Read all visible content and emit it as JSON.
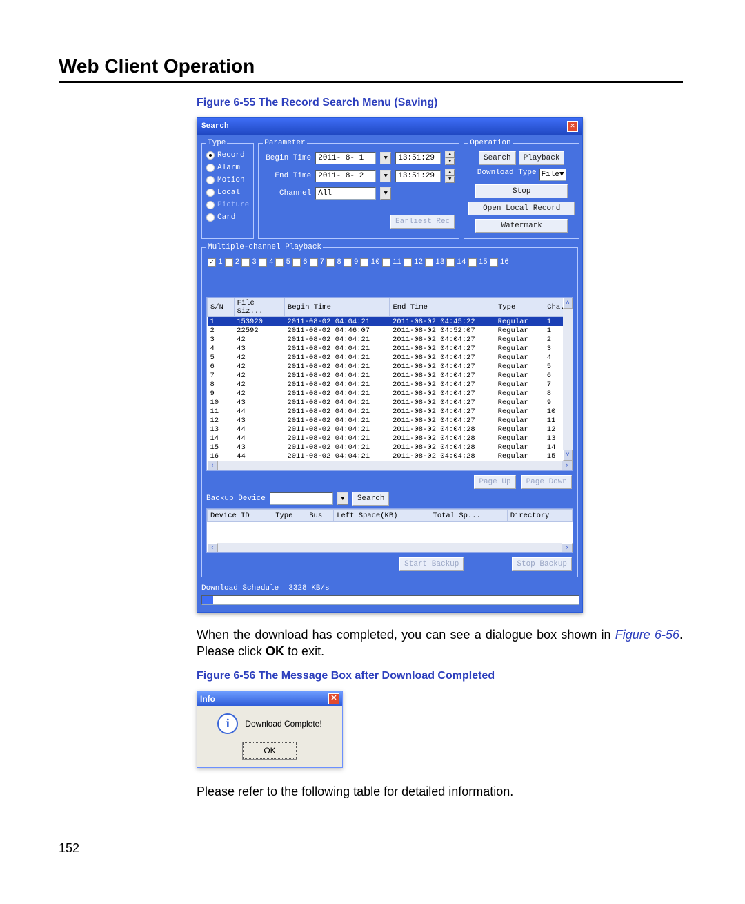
{
  "page": {
    "title": "Web Client Operation",
    "number": "152"
  },
  "caption1": "Figure 6-55 The Record Search Menu (Saving)",
  "caption2": "Figure 6-56 The Message Box after Download Completed",
  "para1a": "When the download has completed, you can see a dialogue box shown in ",
  "para1_figref": "Figure 6-56",
  "para1b": ". Please click ",
  "para1_bold": "OK",
  "para1c": " to exit.",
  "para2": "Please refer to the following table for detailed information.",
  "search": {
    "title": "Search",
    "type_legend": "Type",
    "types": {
      "record": "Record",
      "alarm": "Alarm",
      "motion": "Motion",
      "local": "Local",
      "picture": "Picture",
      "card": "Card"
    },
    "param_legend": "Parameter",
    "begin_time_label": "Begin Time",
    "end_time_label": "End Time",
    "channel_label": "Channel",
    "begin_date": "2011- 8- 1",
    "end_date": "2011- 8- 2",
    "begin_time": "13:51:29",
    "end_time": "13:51:29",
    "channel_val": "All",
    "earliest_btn": "Earliest Rec",
    "op_legend": "Operation",
    "op": {
      "search": "Search",
      "playback": "Playback",
      "dl_type_label": "Download Type",
      "dl_type_val": "File",
      "stop": "Stop",
      "open_local": "Open Local Record",
      "watermark": "Watermark"
    },
    "mcp_legend": "Multiple-channel Playback",
    "mcp_channels": [
      "1",
      "2",
      "3",
      "4",
      "5",
      "6",
      "7",
      "8",
      "9",
      "10",
      "11",
      "12",
      "13",
      "14",
      "15",
      "16"
    ],
    "cols": {
      "sn": "S/N",
      "size": "File Siz...",
      "begin": "Begin Time",
      "end": "End Time",
      "type": "Type",
      "cha": "Cha..."
    },
    "rows": [
      {
        "sn": "1",
        "size": "153920",
        "begin": "2011-08-02 04:04:21",
        "end": "2011-08-02 04:45:22",
        "type": "Regular",
        "cha": "1",
        "sel": true
      },
      {
        "sn": "2",
        "size": "22592",
        "begin": "2011-08-02 04:46:07",
        "end": "2011-08-02 04:52:07",
        "type": "Regular",
        "cha": "1"
      },
      {
        "sn": "3",
        "size": "42",
        "begin": "2011-08-02 04:04:21",
        "end": "2011-08-02 04:04:27",
        "type": "Regular",
        "cha": "2"
      },
      {
        "sn": "4",
        "size": "43",
        "begin": "2011-08-02 04:04:21",
        "end": "2011-08-02 04:04:27",
        "type": "Regular",
        "cha": "3"
      },
      {
        "sn": "5",
        "size": "42",
        "begin": "2011-08-02 04:04:21",
        "end": "2011-08-02 04:04:27",
        "type": "Regular",
        "cha": "4"
      },
      {
        "sn": "6",
        "size": "42",
        "begin": "2011-08-02 04:04:21",
        "end": "2011-08-02 04:04:27",
        "type": "Regular",
        "cha": "5"
      },
      {
        "sn": "7",
        "size": "42",
        "begin": "2011-08-02 04:04:21",
        "end": "2011-08-02 04:04:27",
        "type": "Regular",
        "cha": "6"
      },
      {
        "sn": "8",
        "size": "42",
        "begin": "2011-08-02 04:04:21",
        "end": "2011-08-02 04:04:27",
        "type": "Regular",
        "cha": "7"
      },
      {
        "sn": "9",
        "size": "42",
        "begin": "2011-08-02 04:04:21",
        "end": "2011-08-02 04:04:27",
        "type": "Regular",
        "cha": "8"
      },
      {
        "sn": "10",
        "size": "43",
        "begin": "2011-08-02 04:04:21",
        "end": "2011-08-02 04:04:27",
        "type": "Regular",
        "cha": "9"
      },
      {
        "sn": "11",
        "size": "44",
        "begin": "2011-08-02 04:04:21",
        "end": "2011-08-02 04:04:27",
        "type": "Regular",
        "cha": "10"
      },
      {
        "sn": "12",
        "size": "43",
        "begin": "2011-08-02 04:04:21",
        "end": "2011-08-02 04:04:27",
        "type": "Regular",
        "cha": "11"
      },
      {
        "sn": "13",
        "size": "44",
        "begin": "2011-08-02 04:04:21",
        "end": "2011-08-02 04:04:28",
        "type": "Regular",
        "cha": "12"
      },
      {
        "sn": "14",
        "size": "44",
        "begin": "2011-08-02 04:04:21",
        "end": "2011-08-02 04:04:28",
        "type": "Regular",
        "cha": "13"
      },
      {
        "sn": "15",
        "size": "43",
        "begin": "2011-08-02 04:04:21",
        "end": "2011-08-02 04:04:28",
        "type": "Regular",
        "cha": "14"
      },
      {
        "sn": "16",
        "size": "44",
        "begin": "2011-08-02 04:04:21",
        "end": "2011-08-02 04:04:28",
        "type": "Regular",
        "cha": "15"
      }
    ],
    "page_up": "Page Up",
    "page_down": "Page Down",
    "backup_device_label": "Backup Device",
    "backup_search": "Search",
    "dev_cols": {
      "id": "Device ID",
      "type": "Type",
      "bus": "Bus",
      "left": "Left Space(KB)",
      "total": "Total Sp...",
      "dir": "Directory"
    },
    "start_backup": "Start Backup",
    "stop_backup": "Stop Backup",
    "schedule_label": "Download Schedule",
    "schedule_rate": "3328 KB/s"
  },
  "msgbox": {
    "title": "Info",
    "text": "Download Complete!",
    "ok": "OK"
  }
}
